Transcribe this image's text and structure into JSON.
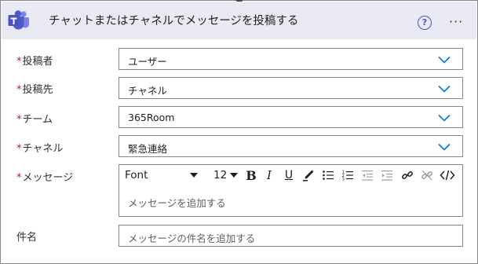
{
  "header": {
    "title": "チャットまたはチャネルでメッセージを投稿する",
    "help_label": "?",
    "more_label": "···"
  },
  "fields": [
    {
      "label": "投稿者",
      "required": "*",
      "value": "ユーザー"
    },
    {
      "label": "投稿先",
      "required": "*",
      "value": "チャネル"
    },
    {
      "label": "チーム",
      "required": "*",
      "value": "365Room"
    },
    {
      "label": "チャネル",
      "required": "*",
      "value": "緊急連絡"
    }
  ],
  "message": {
    "label": "メッセージ",
    "required": "*",
    "font": "Font",
    "font_size": "12",
    "placeholder": "メッセージを追加する"
  },
  "subject": {
    "label": "件名",
    "placeholder": "メッセージの件名を追加する"
  },
  "colors": {
    "header_bg": "#e9eaf6",
    "accent": "#4f52b2",
    "required": "#a4262c",
    "chevron": "#0078d4"
  }
}
